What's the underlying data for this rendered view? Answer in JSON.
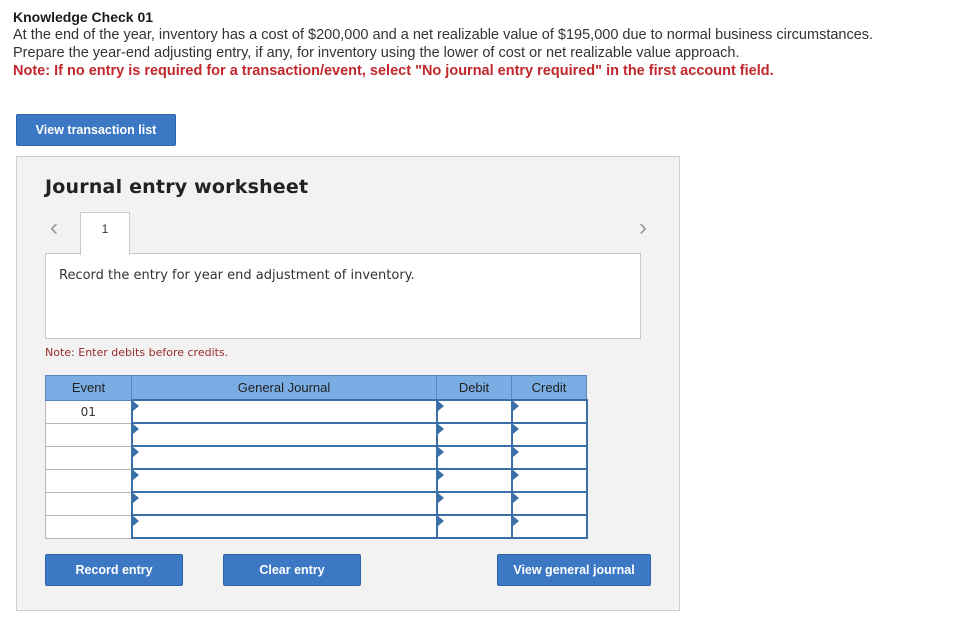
{
  "question": {
    "title": "Knowledge Check 01",
    "line1": "At the end of the year, inventory has a cost of $200,000 and a net realizable value of $195,000 due to normal business circumstances.",
    "line2": "Prepare the year-end adjusting entry, if any, for inventory using the lower of cost or net realizable value approach.",
    "note": "Note: If no entry is required for a transaction/event, select \"No journal entry required\" in the first account field."
  },
  "buttons": {
    "view_transaction_list": "View transaction list",
    "record_entry": "Record entry",
    "clear_entry": "Clear entry",
    "view_general_journal": "View general journal"
  },
  "worksheet": {
    "title": "Journal entry worksheet",
    "nav_prev_icon": "chevron-left-icon",
    "nav_next_icon": "chevron-right-icon",
    "active_tab": "1",
    "description": "Record the entry for year end adjustment of inventory.",
    "note": "Note: Enter debits before credits."
  },
  "journal_table": {
    "headers": {
      "event": "Event",
      "general_journal": "General Journal",
      "debit": "Debit",
      "credit": "Credit"
    },
    "rows": [
      {
        "event": "01",
        "account": "",
        "debit": "",
        "credit": ""
      },
      {
        "event": "",
        "account": "",
        "debit": "",
        "credit": ""
      },
      {
        "event": "",
        "account": "",
        "debit": "",
        "credit": ""
      },
      {
        "event": "",
        "account": "",
        "debit": "",
        "credit": ""
      },
      {
        "event": "",
        "account": "",
        "debit": "",
        "credit": ""
      },
      {
        "event": "",
        "account": "",
        "debit": "",
        "credit": ""
      }
    ]
  },
  "colors": {
    "button_blue": "#3c78c3",
    "header_blue": "#7aade4",
    "note_red": "#c1272d"
  }
}
